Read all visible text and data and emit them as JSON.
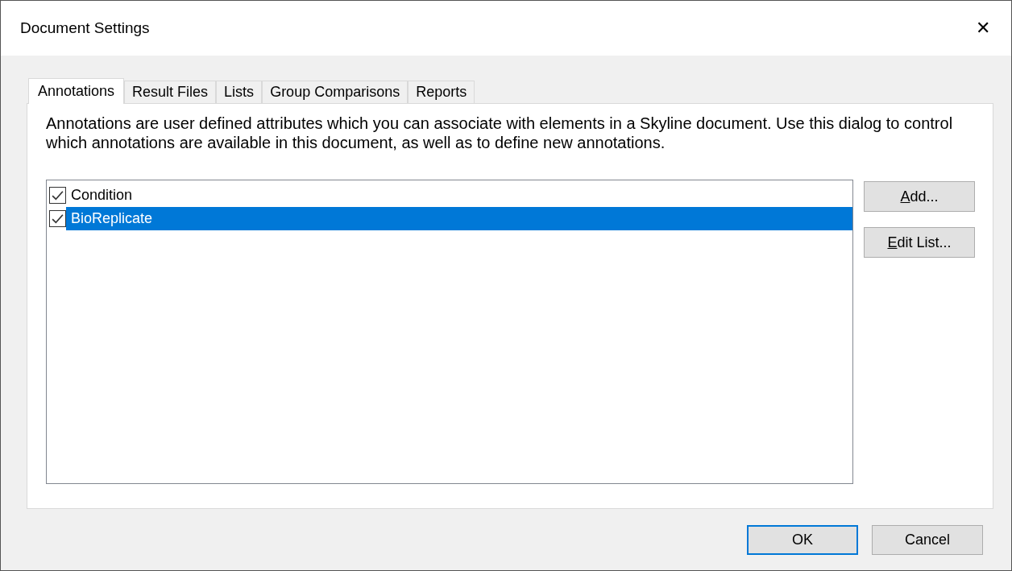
{
  "window": {
    "title": "Document Settings",
    "close": "✕"
  },
  "tabs": [
    {
      "label": "Annotations",
      "selected": true
    },
    {
      "label": "Result Files",
      "selected": false
    },
    {
      "label": "Lists",
      "selected": false
    },
    {
      "label": "Group Comparisons",
      "selected": false
    },
    {
      "label": "Reports",
      "selected": false
    }
  ],
  "description": "Annotations are user defined attributes which you can associate with elements in a Skyline document. Use this dialog to control which annotations are available in this document, as well as to define new annotations.",
  "annotations": [
    {
      "name": "Condition",
      "checked": true,
      "selected": false
    },
    {
      "name": "BioReplicate",
      "checked": true,
      "selected": true
    }
  ],
  "side_buttons": [
    {
      "label": "Add...",
      "first_letter_underlined": true
    },
    {
      "label": "Edit List...",
      "first_letter_underlined": true
    }
  ],
  "footer_buttons": [
    {
      "label": "OK",
      "default": true
    },
    {
      "label": "Cancel",
      "default": false
    }
  ]
}
